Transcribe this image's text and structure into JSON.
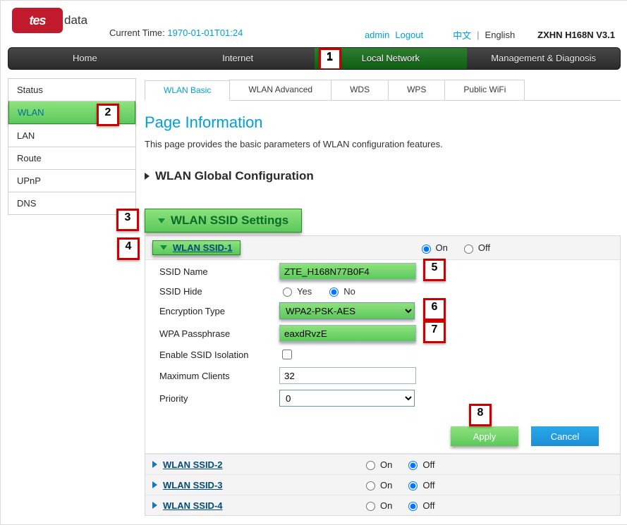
{
  "header": {
    "logo_badge": "tes",
    "logo_text": "data",
    "current_time_label": "Current Time:",
    "current_time_value": "1970-01-01T01:24",
    "user": "admin",
    "logout": "Logout",
    "lang_zh": "中文",
    "lang_en": "English",
    "model": "ZXHN H168N V3.1"
  },
  "nav": {
    "home": "Home",
    "internet": "Internet",
    "local": "Local Network",
    "mgmt": "Management & Diagnosis"
  },
  "sidebar": [
    "Status",
    "WLAN",
    "LAN",
    "Route",
    "UPnP",
    "DNS"
  ],
  "subtabs": {
    "basic": "WLAN Basic",
    "advanced": "WLAN Advanced",
    "wds": "WDS",
    "wps": "WPS",
    "public": "Public WiFi"
  },
  "page_title": "Page Information",
  "page_desc": "This page provides the basic parameters of WLAN configuration features.",
  "section_global": "WLAN Global Configuration",
  "section_ssid": "WLAN SSID Settings",
  "ssids": {
    "ssid1": "WLAN SSID-1",
    "ssid2": "WLAN SSID-2",
    "ssid3": "WLAN SSID-3",
    "ssid4": "WLAN SSID-4"
  },
  "common": {
    "on": "On",
    "off": "Off",
    "yes": "Yes",
    "no": "No"
  },
  "form": {
    "ssid_name_label": "SSID Name",
    "ssid_name_value": "ZTE_H168N77B0F4",
    "ssid_hide_label": "SSID Hide",
    "enc_label": "Encryption Type",
    "enc_value": "WPA2-PSK-AES",
    "pass_label": "WPA Passphrase",
    "pass_value": "eaxdRvzE",
    "iso_label": "Enable SSID Isolation",
    "max_label": "Maximum Clients",
    "max_value": "32",
    "prio_label": "Priority",
    "prio_value": "0"
  },
  "buttons": {
    "apply": "Apply",
    "cancel": "Cancel"
  },
  "marks": {
    "1": "1",
    "2": "2",
    "3": "3",
    "4": "4",
    "5": "5",
    "6": "6",
    "7": "7",
    "8": "8"
  }
}
